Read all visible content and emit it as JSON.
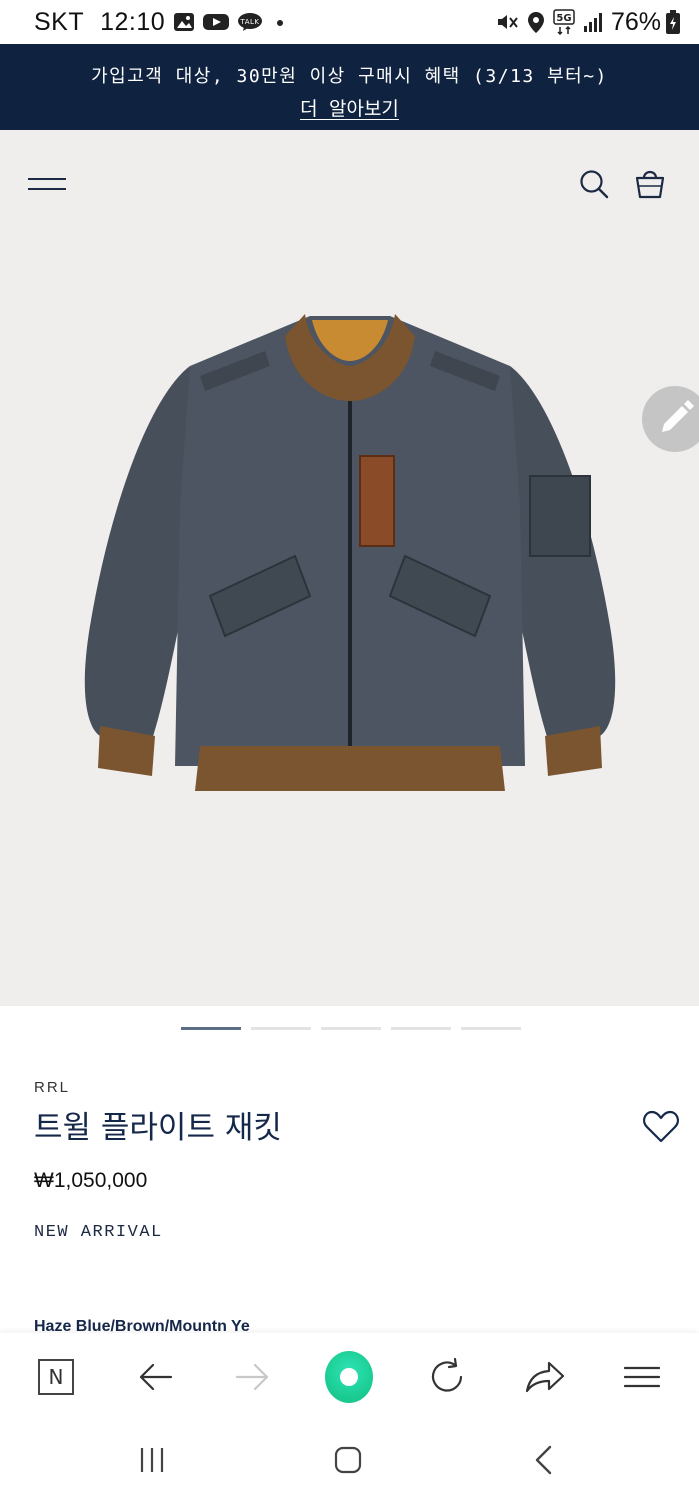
{
  "status_bar": {
    "carrier": "SKT",
    "time": "12:10",
    "battery": "76%",
    "network": "5G"
  },
  "promo": {
    "text": "가입고객 대상, 30만원 이상 구매시 혜택 (3/13 부터~)",
    "link": "더 알아보기"
  },
  "header": {
    "menu_icon": "hamburger-icon",
    "search_icon": "search-icon",
    "bag_icon": "shopping-bag-icon"
  },
  "gallery": {
    "image": "jacket-product-photo",
    "slides": 5,
    "active_slide": 1
  },
  "product": {
    "brand": "RRL",
    "name": "트윌 플라이트 재킷",
    "price": "₩1,050,000",
    "badge": "NEW ARRIVAL",
    "color": "Haze Blue/Brown/Mountn Ye"
  },
  "browser_toolbar": {
    "n_label": "N"
  },
  "colors": {
    "navy": "#0f2340",
    "hero_bg": "#efeeec",
    "accent_green": "#19c98f"
  }
}
